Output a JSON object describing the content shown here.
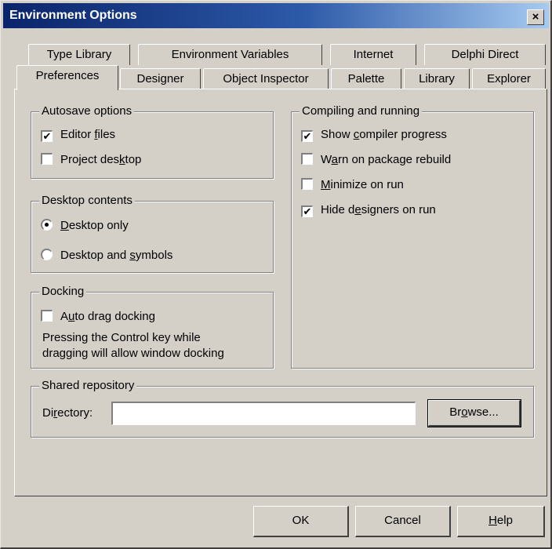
{
  "window": {
    "title": "Environment Options",
    "close_glyph": "×"
  },
  "tabs_back": [
    "Type Library",
    "Environment Variables",
    "Internet",
    "Delphi Direct"
  ],
  "tabs_front": [
    "Preferences",
    "Designer",
    "Object Inspector",
    "Palette",
    "Library",
    "Explorer"
  ],
  "active_tab": "Preferences",
  "autosave": {
    "label": "Autosave options",
    "editor_files": {
      "pre": "Editor ",
      "key": "f",
      "post": "iles",
      "checked": true
    },
    "project_desktop": {
      "pre": "Project des",
      "key": "k",
      "post": "top",
      "checked": false
    }
  },
  "desktop": {
    "label": "Desktop contents",
    "desktop_only": {
      "pre": "",
      "key": "D",
      "post": "esktop only",
      "selected": true
    },
    "desktop_symbols": {
      "pre": "Desktop and ",
      "key": "s",
      "post": "ymbols",
      "selected": false
    }
  },
  "docking": {
    "label": "Docking",
    "auto_drag": {
      "pre": "A",
      "key": "u",
      "post": "to drag docking",
      "checked": false
    },
    "note_line1": "Pressing the Control key while",
    "note_line2": "dragging will allow window docking"
  },
  "compiling": {
    "label": "Compiling and running",
    "show_progress": {
      "pre": "Show ",
      "key": "c",
      "post": "ompiler progress",
      "checked": true
    },
    "warn_rebuild": {
      "pre": "W",
      "key": "a",
      "post": "rn on package rebuild",
      "checked": false
    },
    "minimize": {
      "pre": "",
      "key": "M",
      "post": "inimize on run",
      "checked": false
    },
    "hide_designers": {
      "pre": "Hide d",
      "key": "e",
      "post": "signers on run",
      "checked": true
    }
  },
  "repository": {
    "label": "Shared repository",
    "dir_pre": "Di",
    "dir_key": "r",
    "dir_post": "ectory:",
    "dir_value": "",
    "browse_pre": "Br",
    "browse_key": "o",
    "browse_post": "wse..."
  },
  "buttons": {
    "ok": "OK",
    "cancel": "Cancel",
    "help_key": "H",
    "help_post": "elp"
  },
  "check_glyph": "✔"
}
